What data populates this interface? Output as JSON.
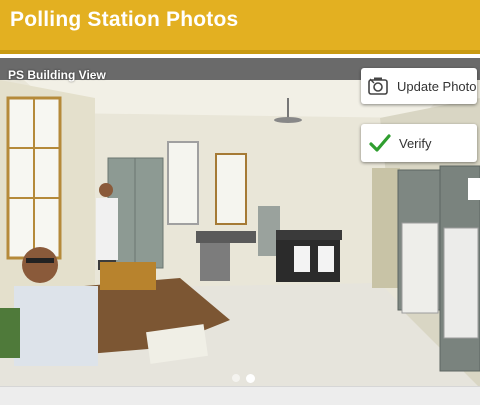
{
  "header": {
    "title": "Polling Station Photos"
  },
  "photo": {
    "label": "PS Building View"
  },
  "actions": {
    "update_label": "Update Photo",
    "verify_label": "Verify"
  },
  "carousel": {
    "count": 2,
    "active_index": 1
  },
  "colors": {
    "header_bg": "#e3b021",
    "verify_check": "#2f9e2f",
    "subbar": "#646464"
  },
  "icons": {
    "update": "camera-refresh-icon",
    "verify": "checkmark-icon"
  }
}
